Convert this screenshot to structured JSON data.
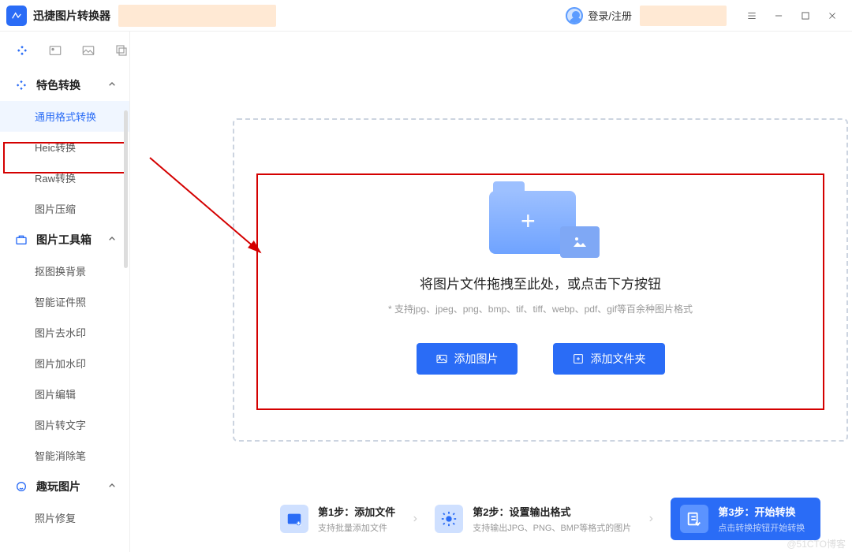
{
  "app": {
    "name": "迅捷图片转换器"
  },
  "titlebar": {
    "login": "登录/注册"
  },
  "sidebar": {
    "groups": [
      {
        "label": "特色转换",
        "items": [
          {
            "label": "通用格式转换",
            "selected": true
          },
          {
            "label": "Heic转换"
          },
          {
            "label": "Raw转换"
          },
          {
            "label": "图片压缩"
          }
        ]
      },
      {
        "label": "图片工具箱",
        "items": [
          {
            "label": "抠图换背景"
          },
          {
            "label": "智能证件照"
          },
          {
            "label": "图片去水印"
          },
          {
            "label": "图片加水印"
          },
          {
            "label": "图片编辑"
          },
          {
            "label": "图片转文字"
          },
          {
            "label": "智能消除笔"
          }
        ]
      },
      {
        "label": "趣玩图片",
        "items": [
          {
            "label": "照片修复"
          }
        ]
      }
    ]
  },
  "dropzone": {
    "title": "将图片文件拖拽至此处，或点击下方按钮",
    "subtitle": "* 支持jpg、jpeg、png、bmp、tif、tiff、webp、pdf、gif等百余种图片格式",
    "add_image": "添加图片",
    "add_folder": "添加文件夹"
  },
  "steps": [
    {
      "title": "第1步：添加文件",
      "sub": "支持批量添加文件"
    },
    {
      "title": "第2步：设置输出格式",
      "sub": "支持输出JPG、PNG、BMP等格式的图片"
    },
    {
      "title": "第3步：开始转换",
      "sub": "点击转换按钮开始转换"
    }
  ],
  "watermark": "@51CTO博客"
}
